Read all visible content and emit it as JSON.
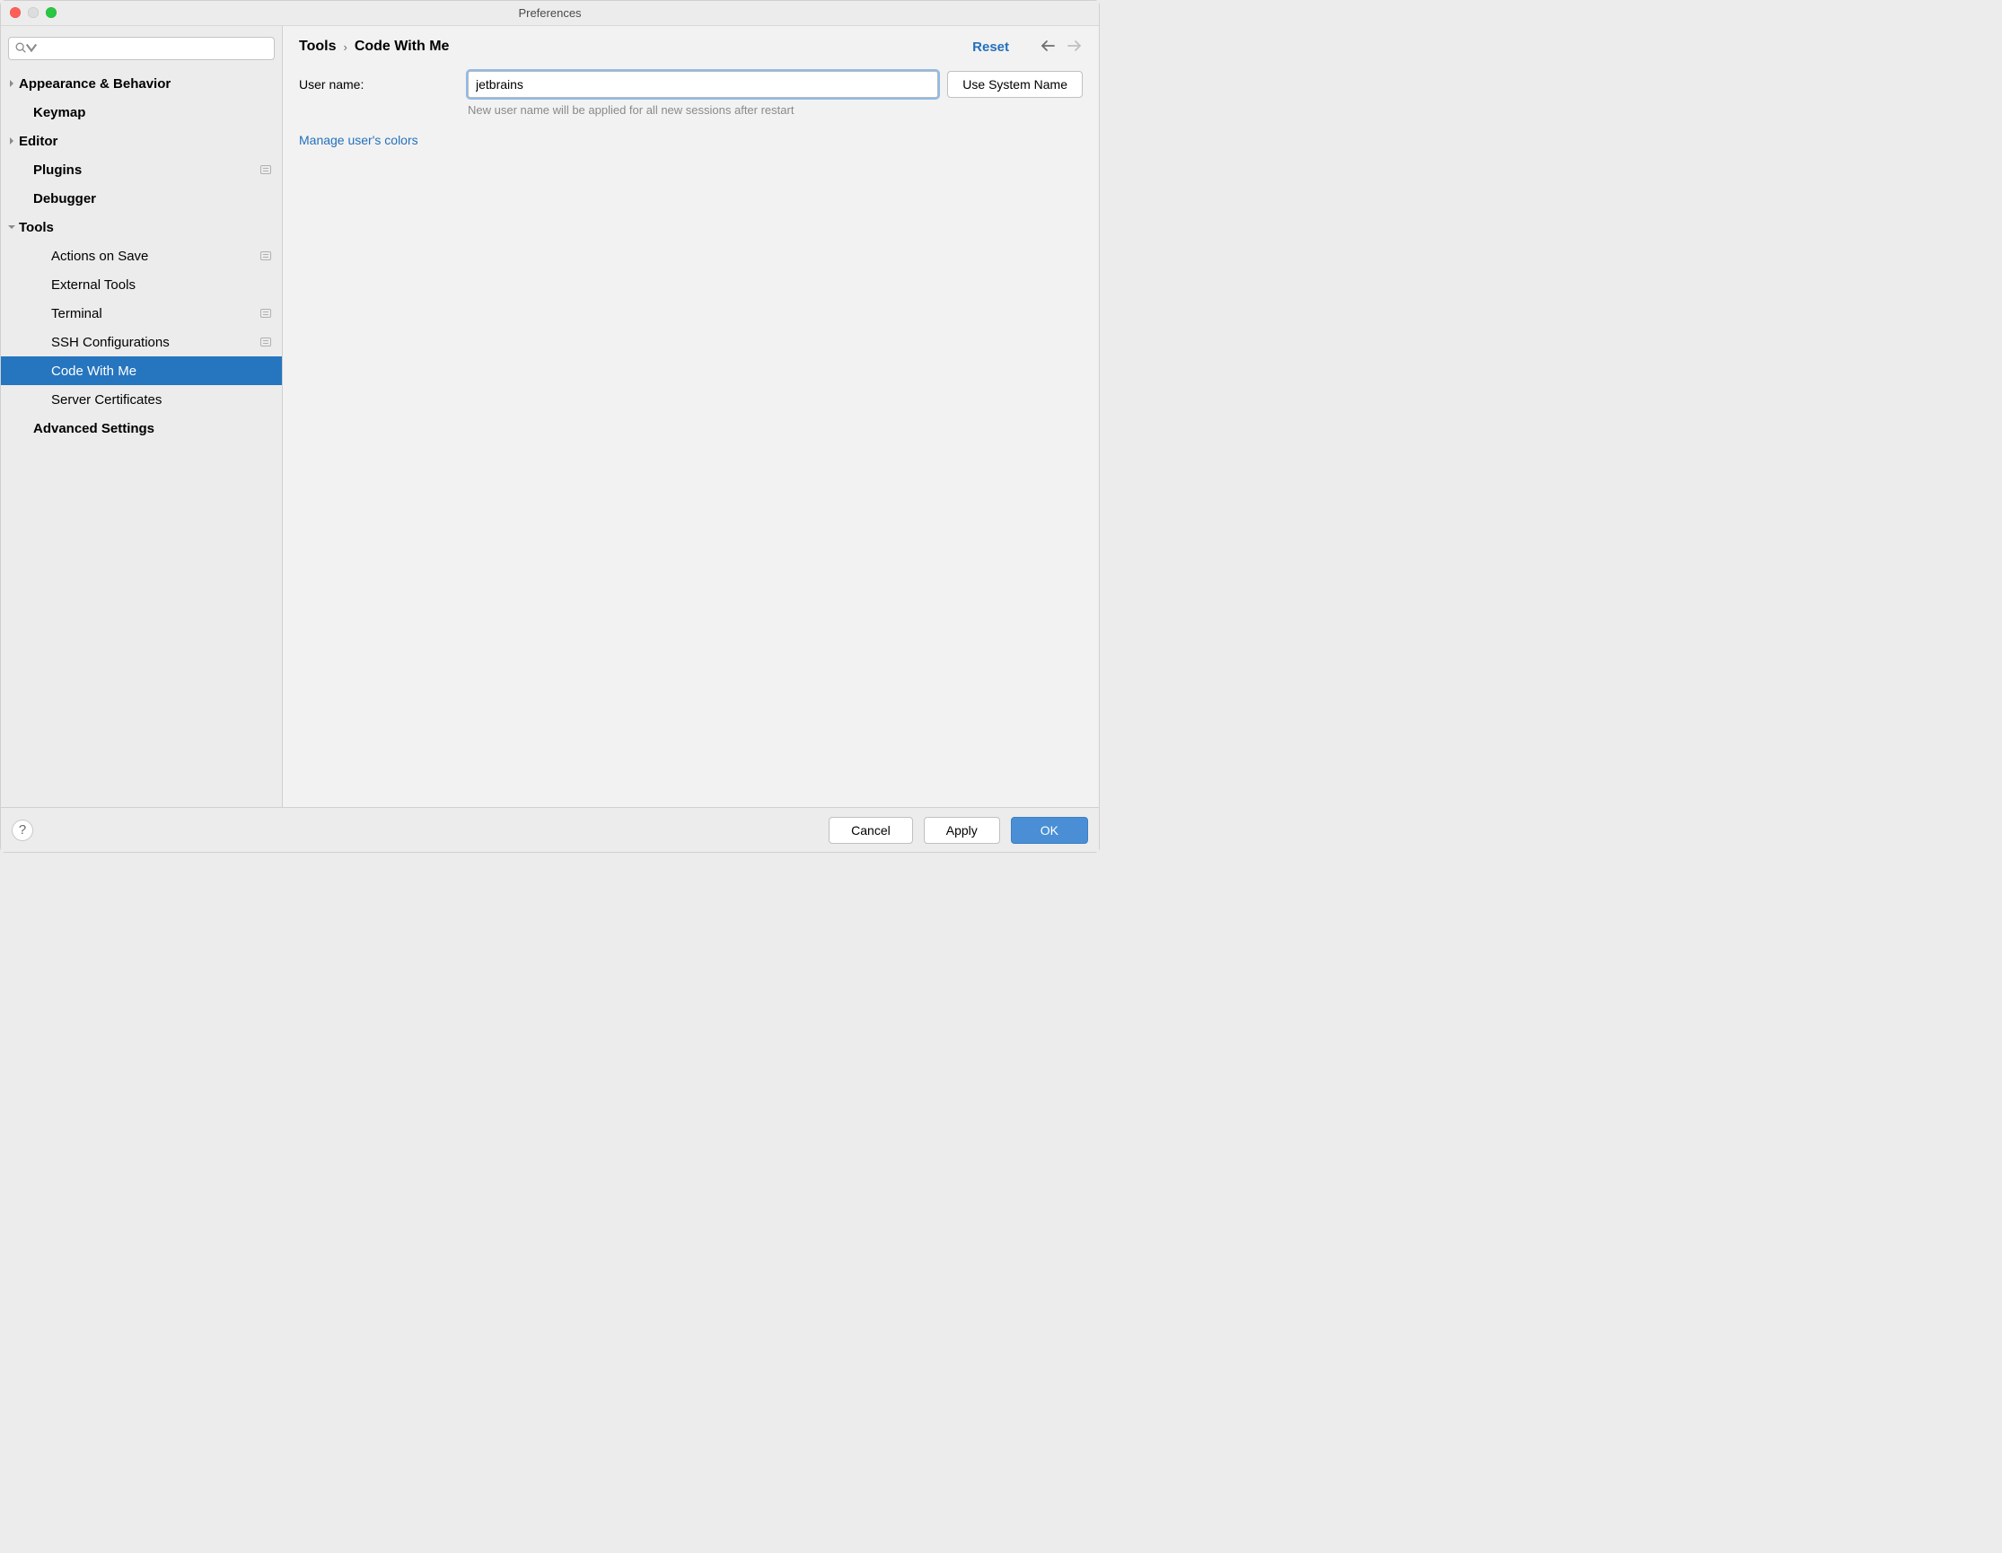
{
  "window": {
    "title": "Preferences"
  },
  "sidebar": {
    "search_placeholder": "",
    "items": [
      {
        "label": "Appearance & Behavior",
        "level": 0,
        "bold": true,
        "arrow": "right",
        "badge": false,
        "selected": false
      },
      {
        "label": "Keymap",
        "level": 0,
        "bold": true,
        "arrow": "",
        "badge": false,
        "selected": false
      },
      {
        "label": "Editor",
        "level": 0,
        "bold": true,
        "arrow": "right",
        "badge": false,
        "selected": false
      },
      {
        "label": "Plugins",
        "level": 0,
        "bold": true,
        "arrow": "",
        "badge": true,
        "selected": false
      },
      {
        "label": "Debugger",
        "level": 0,
        "bold": true,
        "arrow": "",
        "badge": false,
        "selected": false
      },
      {
        "label": "Tools",
        "level": 0,
        "bold": true,
        "arrow": "down",
        "badge": false,
        "selected": false
      },
      {
        "label": "Actions on Save",
        "level": 1,
        "bold": false,
        "arrow": "",
        "badge": true,
        "selected": false
      },
      {
        "label": "External Tools",
        "level": 1,
        "bold": false,
        "arrow": "",
        "badge": false,
        "selected": false
      },
      {
        "label": "Terminal",
        "level": 1,
        "bold": false,
        "arrow": "",
        "badge": true,
        "selected": false
      },
      {
        "label": "SSH Configurations",
        "level": 1,
        "bold": false,
        "arrow": "",
        "badge": true,
        "selected": false
      },
      {
        "label": "Code With Me",
        "level": 1,
        "bold": false,
        "arrow": "",
        "badge": false,
        "selected": true
      },
      {
        "label": "Server Certificates",
        "level": 1,
        "bold": false,
        "arrow": "",
        "badge": false,
        "selected": false
      },
      {
        "label": "Advanced Settings",
        "level": 0,
        "bold": true,
        "arrow": "",
        "badge": false,
        "selected": false
      }
    ]
  },
  "header": {
    "breadcrumb_parent": "Tools",
    "breadcrumb_child": "Code With Me",
    "reset_label": "Reset"
  },
  "form": {
    "username_label": "User name:",
    "username_value": "jetbrains",
    "use_system_name_label": "Use System Name",
    "hint": "New user name will be applied for all new sessions after restart",
    "manage_colors_link": "Manage user's colors"
  },
  "footer": {
    "help_glyph": "?",
    "cancel_label": "Cancel",
    "apply_label": "Apply",
    "ok_label": "OK"
  }
}
